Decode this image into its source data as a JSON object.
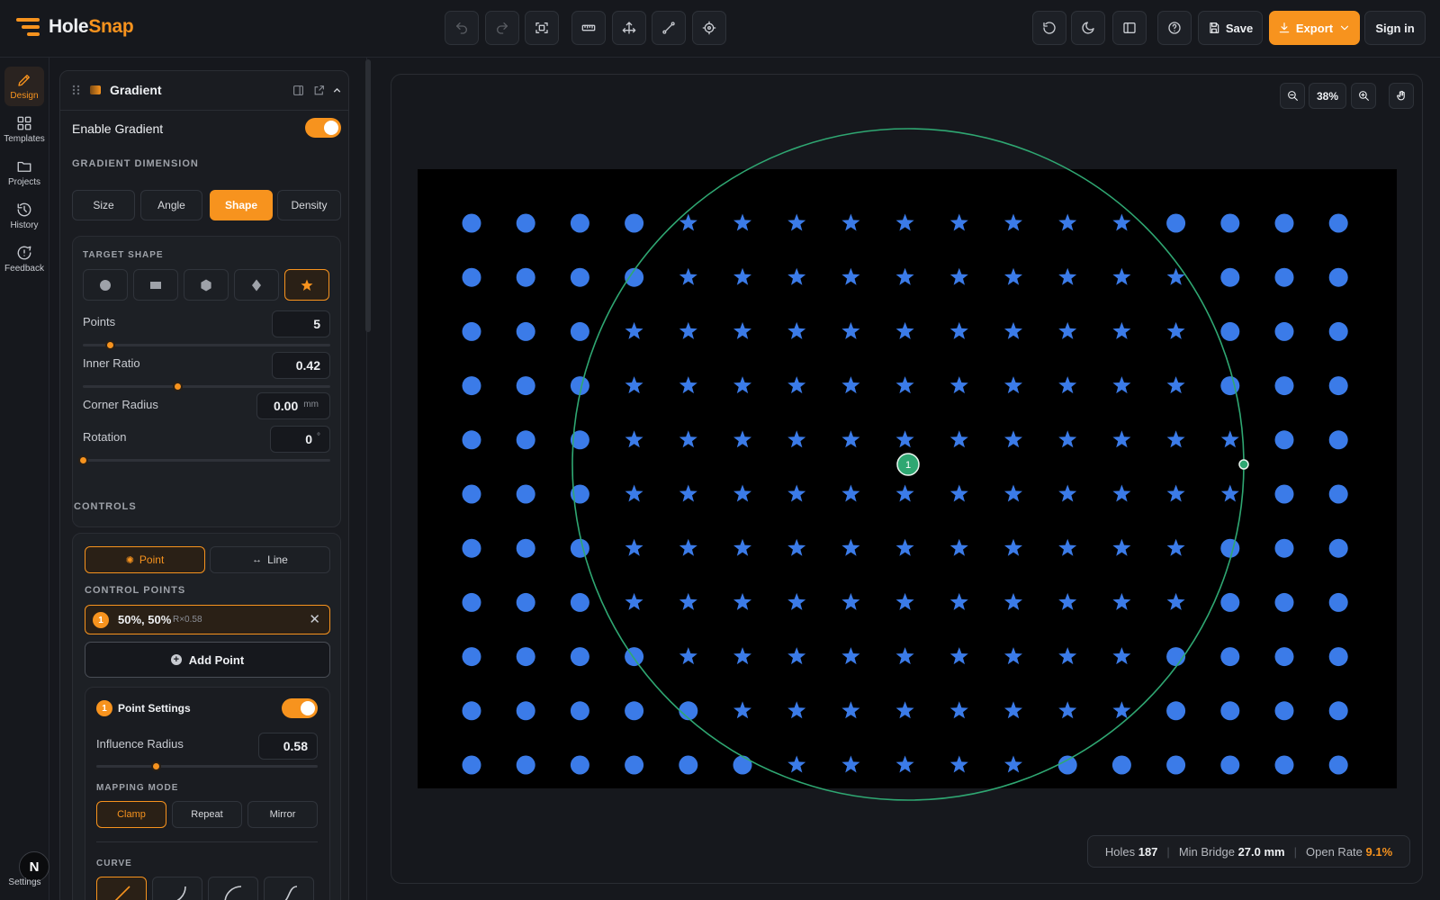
{
  "app": {
    "name_a": "Hole",
    "name_b": "Snap"
  },
  "toolbar": {
    "tools": [
      "undo-icon",
      "redo-icon",
      "fit-icon",
      "ruler-icon",
      "move-icon",
      "line-tool-icon",
      "target-icon"
    ],
    "right_icons": [
      "reset-icon",
      "moon-icon",
      "panel-icon",
      "help-icon"
    ],
    "save_label": "Save",
    "export_label": "Export",
    "signin_label": "Sign in"
  },
  "rail": {
    "items": [
      {
        "label": "Design",
        "icon": "pen-icon"
      },
      {
        "label": "Templates",
        "icon": "grid-icon"
      },
      {
        "label": "Projects",
        "icon": "folder-icon"
      },
      {
        "label": "History",
        "icon": "history-icon"
      },
      {
        "label": "Feedback",
        "icon": "feedback-icon"
      }
    ],
    "avatar": "N",
    "settings_label": "Settings"
  },
  "panel": {
    "title": "Gradient",
    "enable_label": "Enable Gradient",
    "enable_on": true,
    "dimension_label": "GRADIENT DIMENSION",
    "dimension_tabs": [
      "Size",
      "Angle",
      "Shape",
      "Density"
    ],
    "dimension_selected": "Shape",
    "target_shape_label": "TARGET SHAPE",
    "target_shapes": [
      "circle-icon",
      "rectangle-icon",
      "hexagon-icon",
      "diamond-icon",
      "star-icon"
    ],
    "target_shape_selected": "star-icon",
    "points_label": "Points",
    "points_value": "5",
    "points_level": 0.11,
    "inner_ratio_label": "Inner Ratio",
    "inner_ratio_value": "0.42",
    "inner_ratio_level": 0.38,
    "corner_radius_label": "Corner Radius",
    "corner_radius_value": "0.00",
    "corner_radius_unit": "mm",
    "rotation_label": "Rotation",
    "rotation_value": "0",
    "rotation_unit": "°",
    "rotation_level": 0,
    "controls_label": "CONTROLS",
    "control_modes": [
      "Point",
      "Line"
    ],
    "control_mode_selected": "Point",
    "control_points_label": "CONTROL POINTS",
    "control_point": {
      "index": "1",
      "coords": "50%, 50%",
      "radius": "R×0.58"
    },
    "add_point_label": "Add Point",
    "point_settings": {
      "index": "1",
      "title": "Point Settings",
      "enabled": true,
      "influence_label": "Influence Radius",
      "influence_value": "0.58",
      "influence_level": 0.27,
      "mapping_label": "MAPPING MODE",
      "mapping_modes": [
        "Clamp",
        "Repeat",
        "Mirror"
      ],
      "mapping_selected": "Clamp",
      "curve_label": "CURVE",
      "curves": [
        "linear-curve-icon",
        "ease-in-curve-icon",
        "ease-out-curve-icon",
        "ease-in-out-curve-icon"
      ]
    }
  },
  "canvas": {
    "zoom": "38%",
    "grid": {
      "rows": 11,
      "cols": 17
    },
    "control_point_label": "1",
    "control_point_pos": [
      0.5,
      0.5
    ],
    "influence_radius": 0.58,
    "dot_color": "#3b7be8",
    "ring_color": "#2fa772"
  },
  "stats": {
    "holes_label": "Holes",
    "holes_value": "187",
    "bridge_label": "Min Bridge",
    "bridge_value": "27.0 mm",
    "open_label": "Open Rate",
    "open_value": "9.1%"
  },
  "colors": {
    "accent": "#f7931e",
    "background": "#16181d",
    "board": "#000000",
    "hole": "#3b7be8",
    "influence": "#2fa772"
  }
}
